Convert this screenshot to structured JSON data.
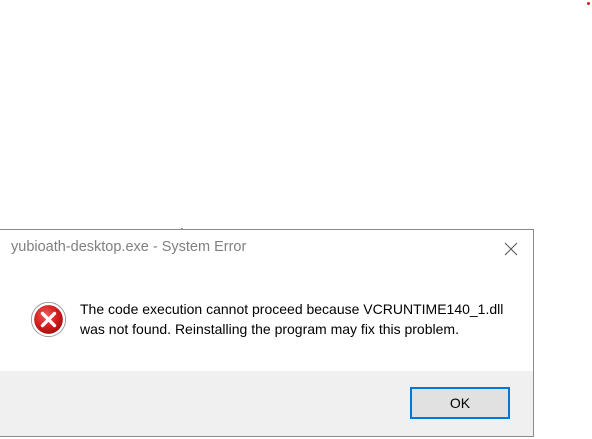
{
  "dialog": {
    "title": "yubioath-desktop.exe - System Error",
    "icon": "error-icon",
    "message": "The code execution cannot proceed because VCRUNTIME140_1.dll was not found. Reinstalling the program may fix this problem.",
    "ok_label": "OK",
    "close_icon": "close-icon"
  },
  "colors": {
    "title_text": "#808080",
    "error_red": "#c9191e",
    "footer_bg": "#f0f0f0",
    "focus_border": "#0078d7"
  }
}
